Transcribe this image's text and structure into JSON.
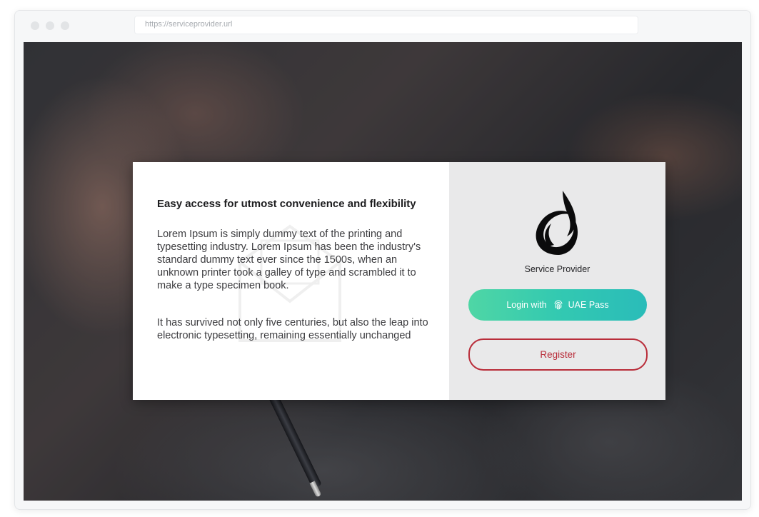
{
  "browser": {
    "url": "https://serviceprovider.url"
  },
  "card": {
    "heading": "Easy access for utmost convenience and flexibility",
    "paragraph_1": "Lorem Ipsum is simply dummy text of the printing and typesetting industry. Lorem Ipsum has been the industry's standard dummy text ever since the 1500s, when an unknown printer took a galley of type and scrambled it to make a type specimen book.",
    "paragraph_2": "It has survived not only five centuries, but also the leap into electronic typesetting, remaining essentially unchanged"
  },
  "provider": {
    "name": "Service Provider",
    "logo_icon": "swirl-logo-icon"
  },
  "actions": {
    "login_prefix": "Login with",
    "login_icon": "fingerprint-icon",
    "login_suffix": "UAE Pass",
    "register_label": "Register"
  },
  "colors": {
    "login_gradient_start": "#4fd6a5",
    "login_gradient_end": "#2abcb9",
    "register_accent": "#b92d3a"
  }
}
